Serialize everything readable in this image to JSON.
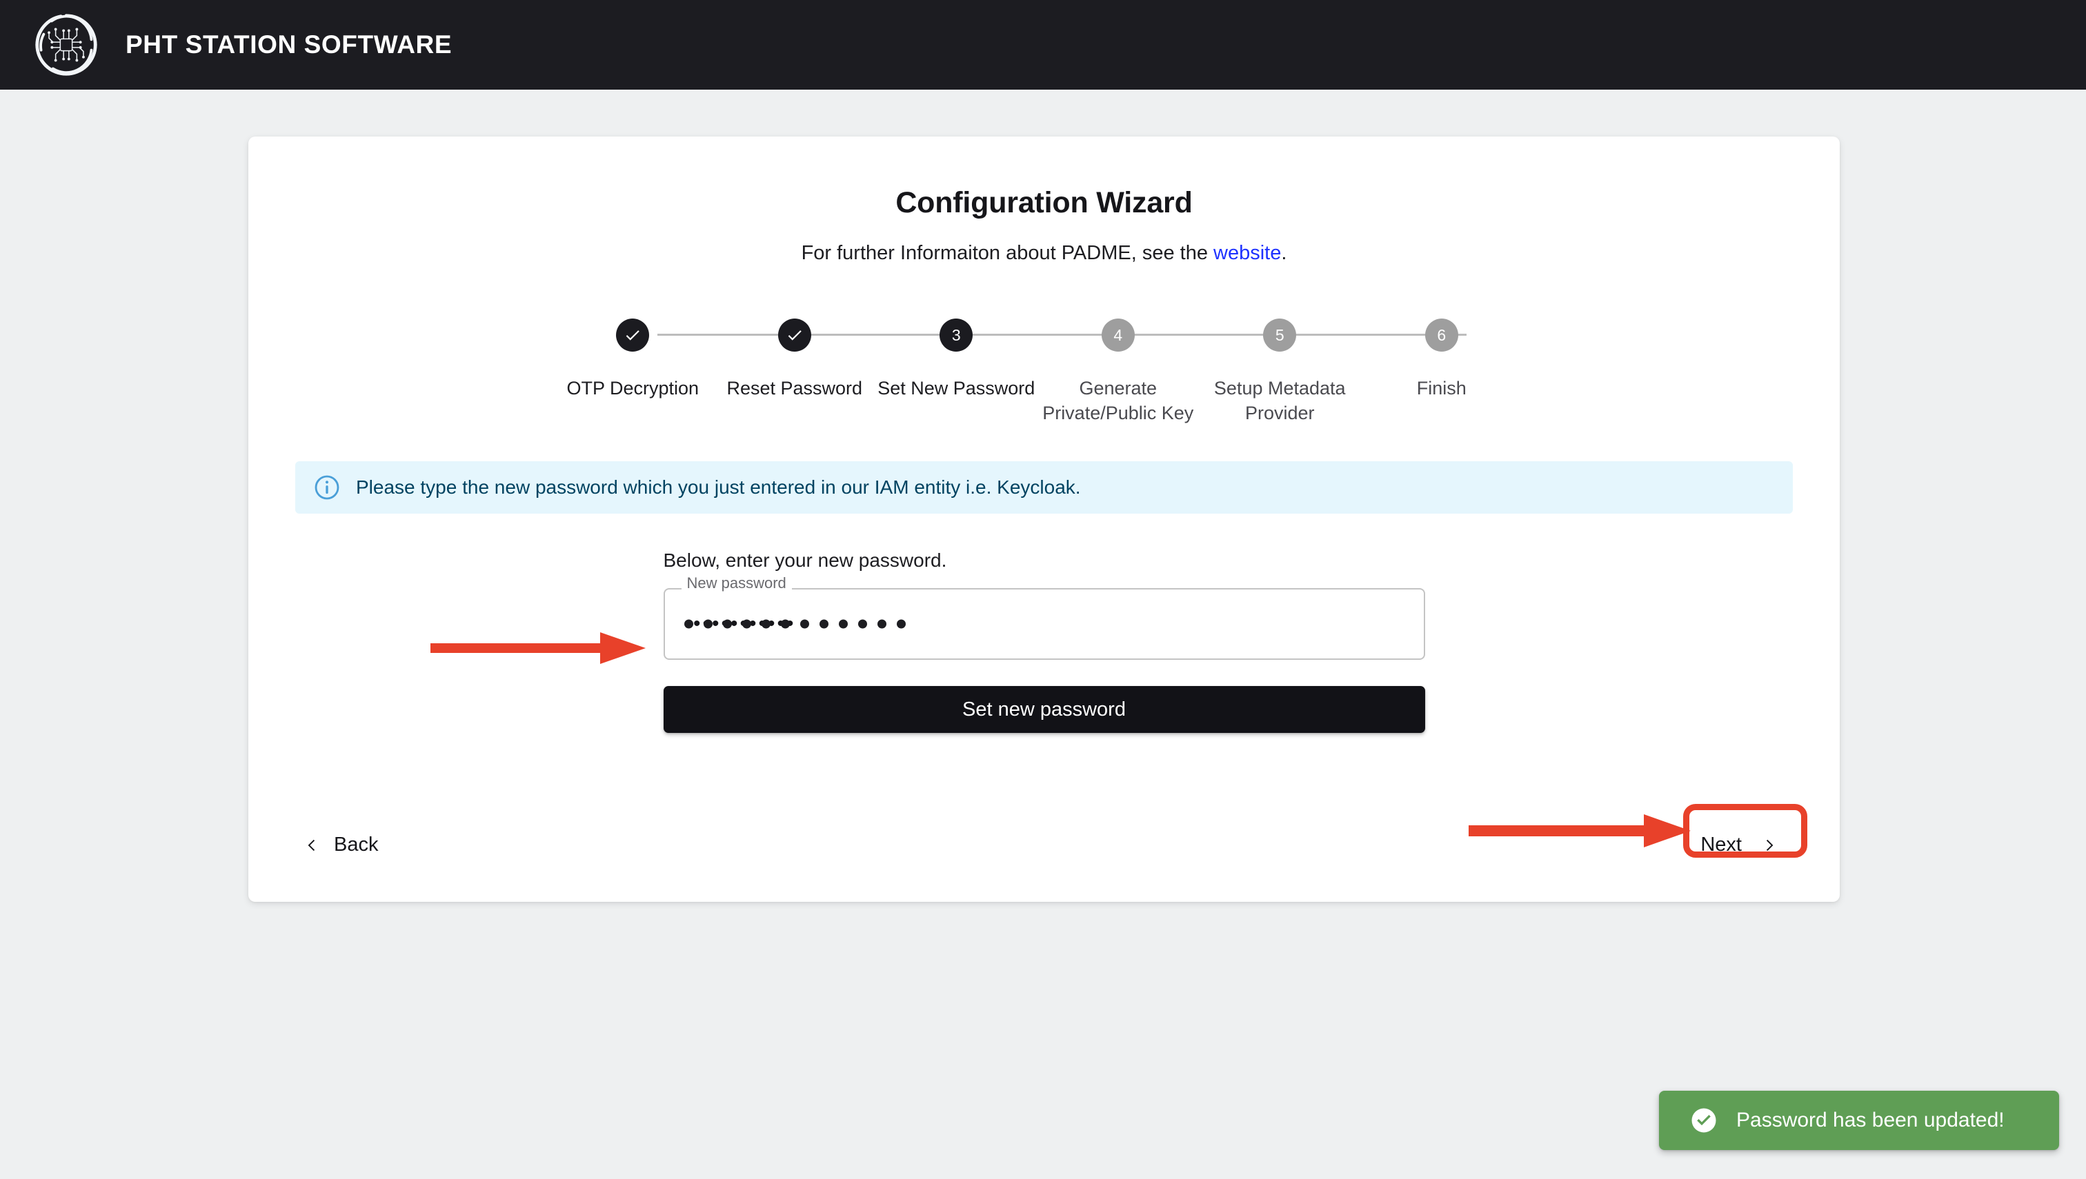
{
  "header": {
    "app_title": "PHT STATION SOFTWARE",
    "logo_name": "pht-chip-logo",
    "background_color": "#1c1c21"
  },
  "card": {
    "title": "Configuration Wizard",
    "subtitle_prefix": "For further Informaiton about PADME, see the ",
    "subtitle_link": "website",
    "subtitle_suffix": ".",
    "link_color": "#1e32ff"
  },
  "stepper": {
    "active_index": 3,
    "steps": [
      {
        "number": "1",
        "label": "OTP Decryption",
        "state": "done"
      },
      {
        "number": "2",
        "label": "Reset Password",
        "state": "done"
      },
      {
        "number": "3",
        "label": "Set New Password",
        "state": "active"
      },
      {
        "number": "4",
        "label": "Generate Private/Public Key",
        "state": "pending"
      },
      {
        "number": "5",
        "label": "Setup Metadata Provider",
        "state": "pending"
      },
      {
        "number": "6",
        "label": "Finish",
        "state": "pending"
      }
    ],
    "done_color": "#1b1b20",
    "pending_color": "#9e9e9e"
  },
  "alert": {
    "icon": "info-circle-icon",
    "message": "Please type the new password which you just entered in our IAM entity i.e. Keycloak.",
    "background_color": "#e5f6fd",
    "text_color": "#014361"
  },
  "form": {
    "helper_text": "Below, enter your new password.",
    "password_label": "New password",
    "password_placeholder": "",
    "password_value": "************",
    "password_masked_length": 12,
    "submit_label": "Set new password"
  },
  "navigation": {
    "back_label": "Back",
    "next_label": "Next"
  },
  "annotations": {
    "color": "#e8412a",
    "arrow_to_password_field": "arrow-right",
    "arrow_to_next_button": "arrow-right",
    "highlight_next_button": "rounded-rect-outline"
  },
  "toast": {
    "message": "Password has been updated!",
    "icon": "check-circle-icon",
    "background_color": "#5f9e55"
  }
}
